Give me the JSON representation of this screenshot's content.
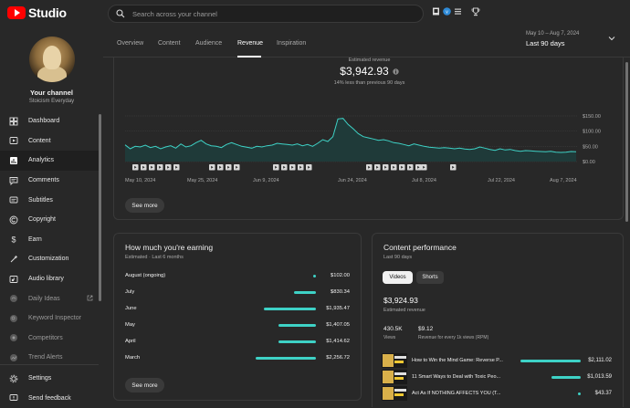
{
  "app": {
    "logo_text": "Studio"
  },
  "search": {
    "placeholder": "Search across your channel"
  },
  "channel": {
    "title": "Your channel",
    "handle": "Stoicism Everyday"
  },
  "nav": [
    {
      "label": "Dashboard",
      "icon": "dashboard-icon",
      "active": false,
      "dim": false
    },
    {
      "label": "Content",
      "icon": "content-icon",
      "active": false,
      "dim": false
    },
    {
      "label": "Analytics",
      "icon": "analytics-icon",
      "active": true,
      "dim": false
    },
    {
      "label": "Comments",
      "icon": "comments-icon",
      "active": false,
      "dim": false
    },
    {
      "label": "Subtitles",
      "icon": "subtitles-icon",
      "active": false,
      "dim": false
    },
    {
      "label": "Copyright",
      "icon": "copyright-icon",
      "active": false,
      "dim": false
    },
    {
      "label": "Earn",
      "icon": "dollar-icon",
      "active": false,
      "dim": false
    },
    {
      "label": "Customization",
      "icon": "customization-icon",
      "active": false,
      "dim": false
    },
    {
      "label": "Audio library",
      "icon": "audio-library-icon",
      "active": false,
      "dim": false
    },
    {
      "label": "Daily Ideas",
      "icon": "daily-ideas-icon",
      "active": false,
      "dim": true
    },
    {
      "label": "Keyword Inspector",
      "icon": "keyword-inspector-icon",
      "active": false,
      "dim": true
    },
    {
      "label": "Competitors",
      "icon": "competitors-icon",
      "active": false,
      "dim": true
    },
    {
      "label": "Trend Alerts",
      "icon": "trend-alerts-icon",
      "active": false,
      "dim": true
    }
  ],
  "nav_bottom": [
    {
      "label": "Settings",
      "icon": "gear-icon"
    },
    {
      "label": "Send feedback",
      "icon": "feedback-icon"
    }
  ],
  "tabs": [
    "Overview",
    "Content",
    "Audience",
    "Revenue",
    "Inspiration"
  ],
  "active_tab": "Revenue",
  "date_range": {
    "range": "May 10 – Aug 7, 2024",
    "label": "Last 90 days"
  },
  "revenue_summary": {
    "label": "Estimated revenue",
    "value": "$3,942.93",
    "comparison": "14% less than previous 90 days"
  },
  "see_more_label": "See more",
  "chart_data": {
    "type": "area",
    "title": "",
    "x_ticks": [
      "May 10, 2024",
      "May 25, 2024",
      "Jun 9, 2024",
      "Jun 24, 2024",
      "Jul 8, 2024",
      "Jul 22, 2024",
      "Aug 7, 2024"
    ],
    "y_ticks": [
      "$150.00",
      "$100.00",
      "$50.00",
      "$0.00"
    ],
    "ylim": [
      0,
      150
    ],
    "grid": true,
    "series": [
      {
        "values": [
          55,
          42,
          50,
          48,
          54,
          46,
          50,
          42,
          48,
          52,
          44,
          58,
          48,
          52,
          62,
          70,
          58,
          52,
          50,
          46,
          56,
          62,
          56,
          50,
          47,
          44,
          50,
          48,
          52,
          54,
          60,
          58,
          56,
          54,
          58,
          52,
          56,
          50,
          60,
          72,
          66,
          82,
          140,
          142,
          122,
          108,
          92,
          82,
          78,
          74,
          70,
          72,
          68,
          62,
          60,
          56,
          52,
          58,
          54,
          50,
          47,
          46,
          44,
          46,
          44,
          42,
          44,
          41,
          40,
          42,
          48,
          44,
          40,
          37,
          42,
          38,
          40,
          36,
          34,
          36,
          35,
          34,
          33,
          32,
          34,
          31,
          30,
          31,
          33,
          32
        ]
      }
    ],
    "color": "#3ed2c6"
  },
  "earnings": {
    "title": "How much you're earning",
    "subtitle": "Estimated · Last 6 months",
    "rows": [
      {
        "month": "August (ongoing)",
        "value": "$102.00",
        "amount": 102.0
      },
      {
        "month": "July",
        "value": "$830.34",
        "amount": 830.34
      },
      {
        "month": "June",
        "value": "$1,935.47",
        "amount": 1935.47
      },
      {
        "month": "May",
        "value": "$1,407.05",
        "amount": 1407.05
      },
      {
        "month": "April",
        "value": "$1,414.62",
        "amount": 1414.62
      },
      {
        "month": "March",
        "value": "$2,256.72",
        "amount": 2256.72
      }
    ]
  },
  "performance": {
    "title": "Content performance",
    "subtitle": "Last 90 days",
    "pills": [
      "Videos",
      "Shorts"
    ],
    "revenue_value": "$3,924.93",
    "revenue_label": "Estimated revenue",
    "views_value": "430.5K",
    "views_label": "Views",
    "rpm_value": "$9.12",
    "rpm_label": "Revenue for every 1k views (RPM)",
    "videos": [
      {
        "title": "How to Win the Mind Game: Reverse P...",
        "value": "$2,111.02",
        "amount": 2111.02
      },
      {
        "title": "11 Smart Ways to Deal with Toxic Peo...",
        "value": "$1,013.59",
        "amount": 1013.59
      },
      {
        "title": "Act As If NOTHING AFFECTS YOU (T...",
        "value": "$43.37",
        "amount": 43.37
      }
    ]
  }
}
